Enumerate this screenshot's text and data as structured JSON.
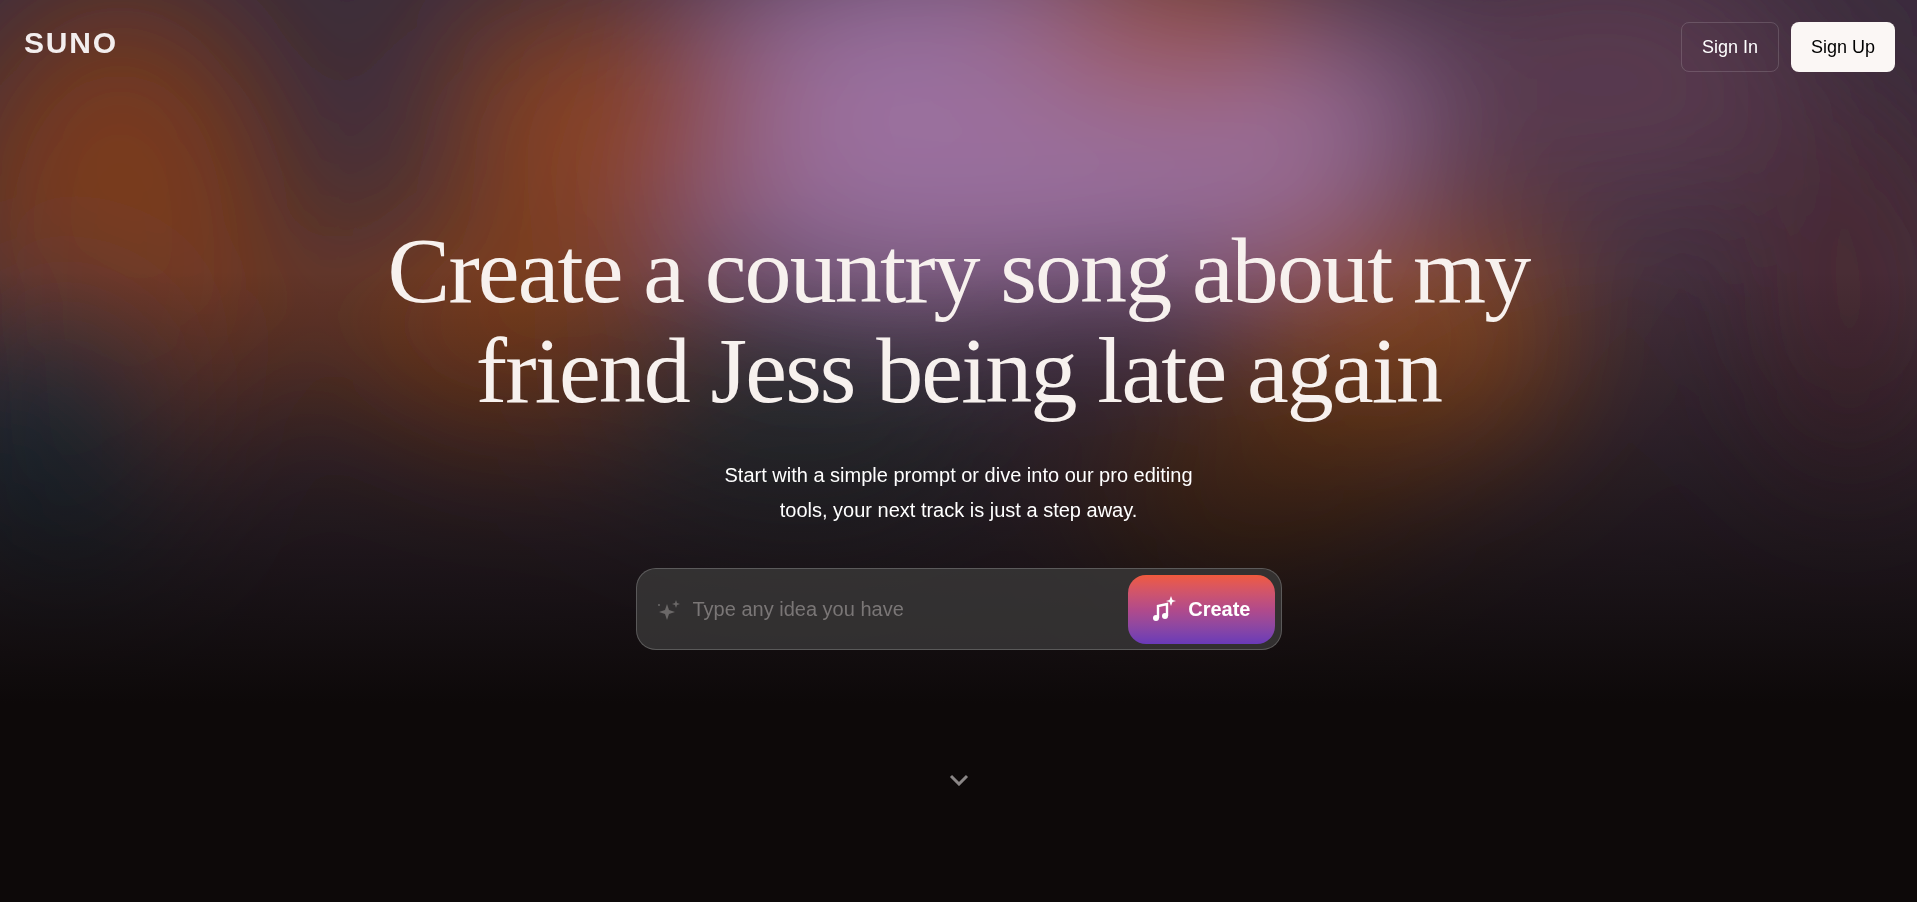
{
  "header": {
    "logo": "SUNO",
    "buttons": [
      {
        "label": "Sign In",
        "kind": "outline"
      },
      {
        "label": "Sign Up",
        "kind": "solid"
      }
    ]
  },
  "hero": {
    "headline": "Create a country song about my friend Jess being late again",
    "subtitle": "Start with a simple prompt or dive into our pro editing tools, your next track is just a step away.",
    "prompt": {
      "placeholder": "Type any idea you have"
    },
    "create_button": "Create"
  }
}
